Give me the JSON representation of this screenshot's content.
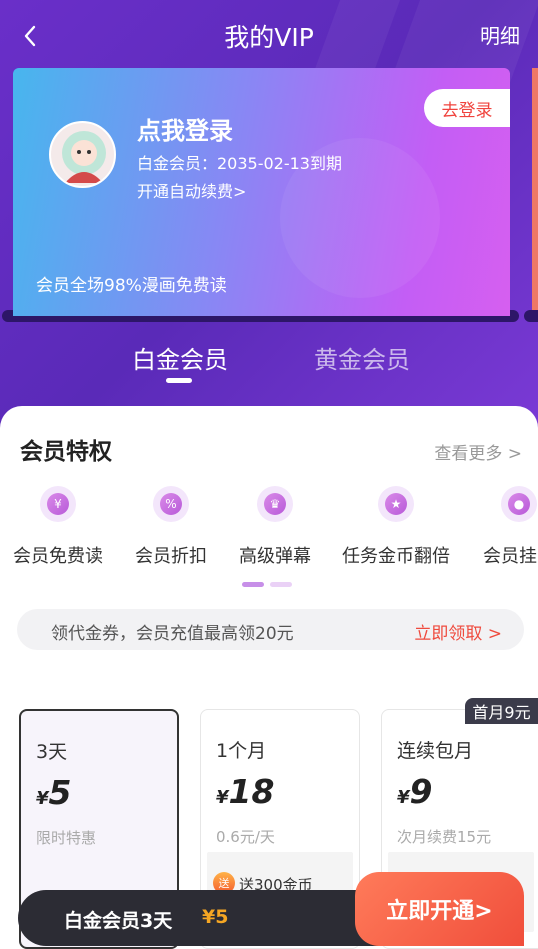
{
  "header": {
    "title": "我的VIP",
    "detail": "明细"
  },
  "card": {
    "title": "点我登录",
    "membership": "白金会员：2035-02-13到期",
    "auto_renew": "开通自动续费>",
    "footer": "会员全场98%漫画免费读",
    "login_button": "去登录"
  },
  "tabs": [
    {
      "label": "白金会员",
      "active": true
    },
    {
      "label": "黄金会员",
      "active": false
    }
  ],
  "privileges": {
    "title": "会员特权",
    "more": "查看更多 >",
    "items": [
      {
        "label": "会员免费读",
        "icon": "free-read-icon"
      },
      {
        "label": "会员折扣",
        "icon": "discount-icon"
      },
      {
        "label": "高级弹幕",
        "icon": "crown-icon"
      },
      {
        "label": "任务金币翻倍",
        "icon": "coin-icon"
      },
      {
        "label": "会员挂",
        "icon": "pendant-icon"
      }
    ]
  },
  "coupon": {
    "text": "领代金券，会员充值最高领20元",
    "link": "立即领取 >"
  },
  "plans": [
    {
      "name": "3天",
      "currency": "¥",
      "price": "5",
      "sub": "限时特惠",
      "gift": "",
      "selected": true
    },
    {
      "name": "1个月",
      "currency": "¥",
      "price": "18",
      "sub": "0.6元/天",
      "gift": "送300金币",
      "selected": false
    },
    {
      "name": "连续包月",
      "currency": "¥",
      "price": "9",
      "sub": "次月续费15元",
      "gift": "",
      "selected": false
    }
  ],
  "first_month_tag": "首月9元",
  "gift_badge": "送",
  "bottom": {
    "label": "白金会员3天",
    "price": "¥5",
    "cta": "立即开通>"
  },
  "colors": {
    "primary_purple": "#6a2fc9",
    "accent_red": "#f04e3b",
    "gold": "#f5a623"
  }
}
